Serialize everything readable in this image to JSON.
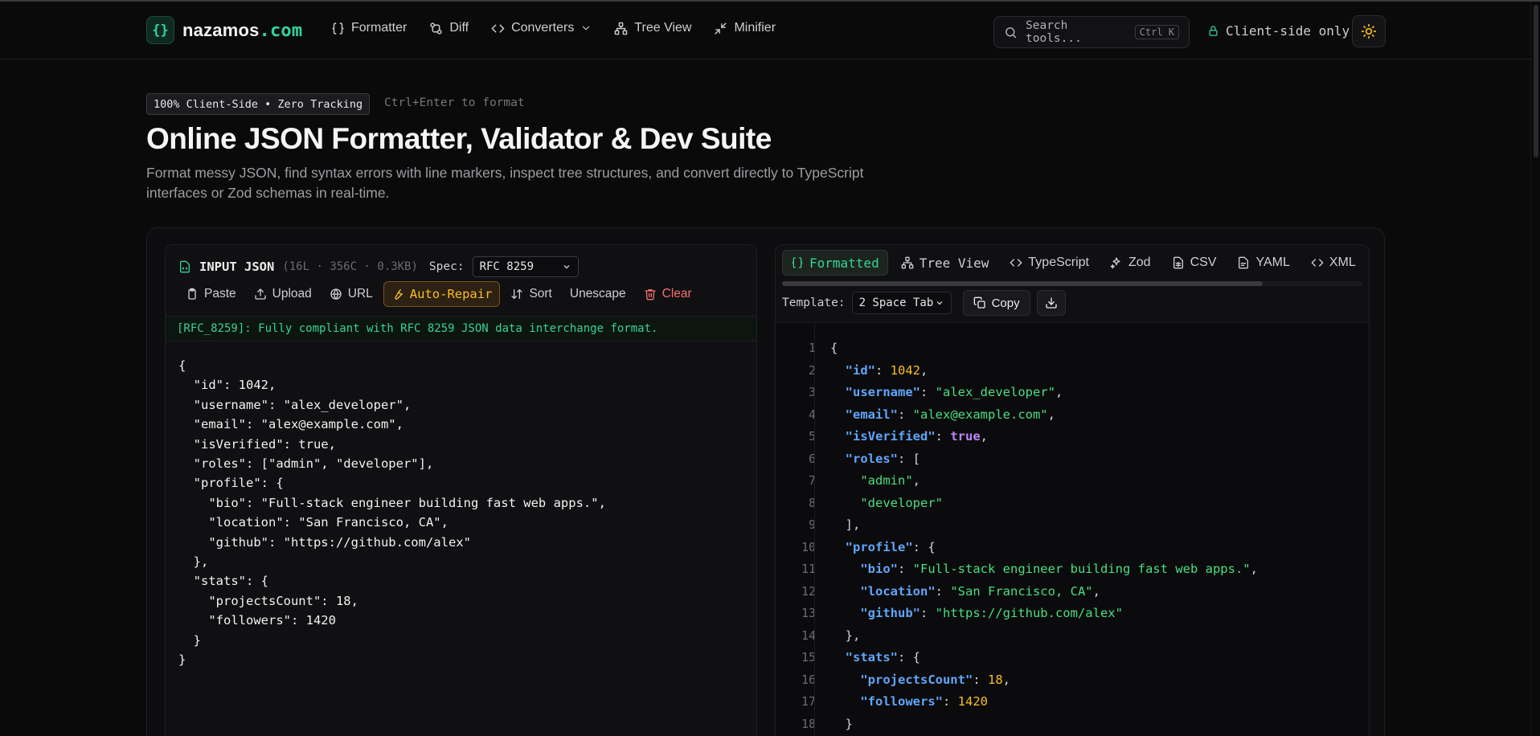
{
  "nav": {
    "logo_mark": "{}",
    "logo_name": "nazamos",
    "logo_tld": ".com",
    "links": [
      {
        "label": "Formatter",
        "icon": "braces-icon"
      },
      {
        "label": "Diff",
        "icon": "git-diff-icon"
      },
      {
        "label": "Converters",
        "icon": "code-icon"
      },
      {
        "label": "Tree View",
        "icon": "tree-icon"
      },
      {
        "label": "Minifier",
        "icon": "minimize-icon"
      }
    ],
    "search_placeholder": "Search tools...",
    "search_shortcut": "Ctrl K",
    "client_only": "Client-side only"
  },
  "hero": {
    "badge": "100% Client-Side • Zero Tracking",
    "shortcut_hint": "Ctrl+Enter to format",
    "title": "Online JSON Formatter, Validator & Dev Suite",
    "subtitle": "Format messy JSON, find syntax errors with line markers, inspect tree structures, and convert directly to TypeScript interfaces or Zod schemas in real-time."
  },
  "input_panel": {
    "title": "INPUT JSON",
    "meta": "(16L · 356C · 0.3KB)",
    "spec_label": "Spec:",
    "spec_value": "RFC 8259",
    "tools": {
      "paste": "Paste",
      "upload": "Upload",
      "url": "URL",
      "auto_repair": "Auto-Repair",
      "sort": "Sort",
      "unescape": "Unescape",
      "clear": "Clear"
    },
    "status": "[RFC_8259]: Fully compliant with RFC 8259 JSON data interchange format.",
    "content": "{\n  \"id\": 1042,\n  \"username\": \"alex_developer\",\n  \"email\": \"alex@example.com\",\n  \"isVerified\": true,\n  \"roles\": [\"admin\", \"developer\"],\n  \"profile\": {\n    \"bio\": \"Full-stack engineer building fast web apps.\",\n    \"location\": \"San Francisco, CA\",\n    \"github\": \"https://github.com/alex\"\n  },\n  \"stats\": {\n    \"projectsCount\": 18,\n    \"followers\": 1420\n  }\n}"
  },
  "output_panel": {
    "tabs": {
      "formatted": "Formatted",
      "tree_view": "Tree View",
      "typescript": "TypeScript",
      "zod": "Zod",
      "csv": "CSV",
      "yaml": "YAML",
      "xml": "XML"
    },
    "template_label": "Template:",
    "template_value": "2 Space Tab",
    "copy_label": "Copy",
    "line_numbers": [
      "1",
      "2",
      "3",
      "4",
      "5",
      "6",
      "7",
      "8",
      "9",
      "10",
      "11",
      "12",
      "13",
      "14",
      "15",
      "16",
      "17",
      "18"
    ],
    "tokens": {
      "k_id": "\"id\"",
      "v_id": "1042",
      "k_username": "\"username\"",
      "v_username": "\"alex_developer\"",
      "k_email": "\"email\"",
      "v_email": "\"alex@example.com\"",
      "k_verified": "\"isVerified\"",
      "v_verified": "true",
      "k_roles": "\"roles\"",
      "v_admin": "\"admin\"",
      "v_developer": "\"developer\"",
      "k_profile": "\"profile\"",
      "k_bio": "\"bio\"",
      "v_bio": "\"Full-stack engineer building fast web apps.\"",
      "k_location": "\"location\"",
      "v_location": "\"San Francisco, CA\"",
      "k_github": "\"github\"",
      "v_github": "\"https://github.com/alex\"",
      "k_stats": "\"stats\"",
      "k_projects": "\"projectsCount\"",
      "v_projects": "18",
      "k_followers": "\"followers\"",
      "v_followers": "1420"
    }
  },
  "colors": {
    "accent": "#34d399",
    "warning": "#fbbf24",
    "danger": "#f87171",
    "json_key": "#60a5fa",
    "json_string": "#4ade80",
    "json_number": "#fbbf24",
    "json_boolean": "#c084fc"
  }
}
